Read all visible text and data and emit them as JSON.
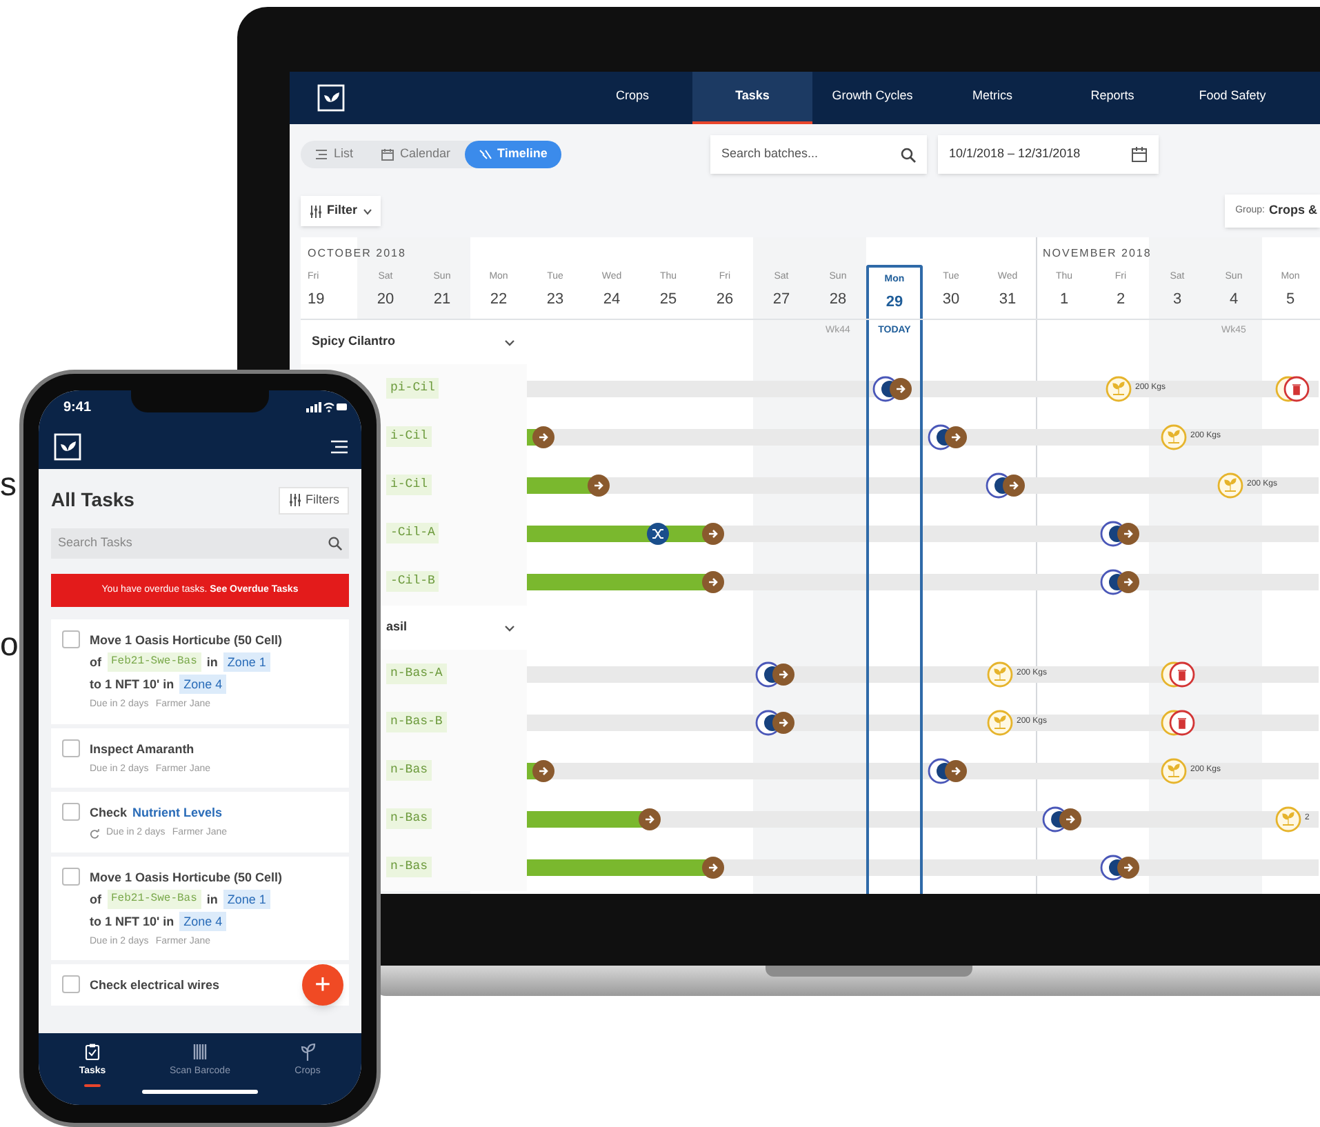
{
  "background_text": [
    "s",
    "o"
  ],
  "desktop": {
    "nav": {
      "tabs": [
        {
          "label": "Crops",
          "selected": false
        },
        {
          "label": "Tasks",
          "selected": true
        },
        {
          "label": "Growth Cycles",
          "selected": false
        },
        {
          "label": "Metrics",
          "selected": false
        },
        {
          "label": "Reports",
          "selected": false
        },
        {
          "label": "Food Safety",
          "selected": false
        }
      ]
    },
    "view_modes": [
      {
        "label": "List",
        "selected": false
      },
      {
        "label": "Calendar",
        "selected": false
      },
      {
        "label": "Timeline",
        "selected": true
      }
    ],
    "search": {
      "placeholder": "Search batches..."
    },
    "date_range": {
      "value": "10/1/2018 – 12/31/2018"
    },
    "filter": {
      "label": "Filter"
    },
    "group_by": {
      "label": "Group:",
      "value": "Crops &"
    },
    "days": [
      {
        "name": "Fri",
        "num": "19",
        "weekend": false,
        "selected": false,
        "month": "OCTOBER 2018"
      },
      {
        "name": "Sat",
        "num": "20",
        "weekend": true,
        "selected": false
      },
      {
        "name": "Sun",
        "num": "21",
        "weekend": true,
        "selected": false
      },
      {
        "name": "Mon",
        "num": "22",
        "weekend": false,
        "selected": false
      },
      {
        "name": "Tue",
        "num": "23",
        "weekend": false,
        "selected": false
      },
      {
        "name": "Wed",
        "num": "24",
        "weekend": false,
        "selected": false
      },
      {
        "name": "Thu",
        "num": "25",
        "weekend": false,
        "selected": false
      },
      {
        "name": "Fri",
        "num": "26",
        "weekend": false,
        "selected": false
      },
      {
        "name": "Sat",
        "num": "27",
        "weekend": true,
        "selected": false
      },
      {
        "name": "Sun",
        "num": "28",
        "weekend": true,
        "selected": false,
        "marker": "Wk44"
      },
      {
        "name": "Mon",
        "num": "29",
        "weekend": false,
        "selected": true,
        "marker": "TODAY"
      },
      {
        "name": "Tue",
        "num": "30",
        "weekend": false,
        "selected": false
      },
      {
        "name": "Wed",
        "num": "31",
        "weekend": false,
        "selected": false
      },
      {
        "name": "Thu",
        "num": "1",
        "weekend": false,
        "selected": false,
        "month": "NOVEMBER 2018"
      },
      {
        "name": "Fri",
        "num": "2",
        "weekend": false,
        "selected": false
      },
      {
        "name": "Sat",
        "num": "3",
        "weekend": true,
        "selected": false
      },
      {
        "name": "Sun",
        "num": "4",
        "weekend": true,
        "selected": false,
        "marker": "Wk45"
      },
      {
        "name": "Mon",
        "num": "5",
        "weekend": false,
        "selected": false
      }
    ],
    "groups": [
      {
        "name": "Spicy Cilantro",
        "expanded": true,
        "rows": [
          {
            "batch": "pi-Cil",
            "level": 0,
            "events": [
              {
                "kind": "transplant"
              },
              {
                "kind": "harvest",
                "label": "200 Kgs"
              },
              {
                "kind": "discard"
              }
            ]
          },
          {
            "batch": "i-Cil",
            "level": 0.02,
            "events": [
              {
                "kind": "move"
              },
              {
                "kind": "transplant"
              },
              {
                "kind": "harvest",
                "label": "200 Kgs"
              }
            ]
          },
          {
            "batch": "i-Cil",
            "level": 0.09,
            "events": [
              {
                "kind": "move"
              },
              {
                "kind": "transplant"
              },
              {
                "kind": "harvest",
                "label": "200 Kgs"
              }
            ]
          },
          {
            "batch": "-Cil-A",
            "level": 0.235,
            "events": [
              {
                "kind": "split"
              },
              {
                "kind": "move"
              },
              {
                "kind": "transplant"
              }
            ]
          },
          {
            "batch": "-Cil-B",
            "level": 0.235,
            "events": [
              {
                "kind": "move"
              },
              {
                "kind": "transplant"
              }
            ]
          }
        ]
      },
      {
        "name": "asil",
        "expanded": true,
        "rows": [
          {
            "batch": "n-Bas-A",
            "level": 0,
            "events": [
              {
                "kind": "transplant"
              },
              {
                "kind": "harvest",
                "label": "200 Kgs"
              },
              {
                "kind": "discard"
              }
            ]
          },
          {
            "batch": "n-Bas-B",
            "level": 0,
            "events": [
              {
                "kind": "transplant"
              },
              {
                "kind": "harvest",
                "label": "200 Kgs"
              },
              {
                "kind": "discard"
              }
            ]
          },
          {
            "batch": "n-Bas",
            "level": 0.02,
            "events": [
              {
                "kind": "move"
              },
              {
                "kind": "transplant"
              },
              {
                "kind": "harvest",
                "label": "200 Kgs"
              }
            ]
          },
          {
            "batch": "n-Bas",
            "level": 0.155,
            "events": [
              {
                "kind": "move"
              },
              {
                "kind": "transplant"
              },
              {
                "kind": "harvest",
                "label": "2"
              }
            ]
          },
          {
            "batch": "n-Bas",
            "level": 0.235,
            "events": [
              {
                "kind": "move"
              },
              {
                "kind": "transplant"
              }
            ]
          }
        ]
      }
    ]
  },
  "phone": {
    "time": "9:41",
    "title": "All Tasks",
    "filters_label": "Filters",
    "search": {
      "placeholder": "Search Tasks"
    },
    "alert": "You have overdue tasks. **See Overdue Tasks**",
    "tasks": [
      {
        "checked": false,
        "recurring": false,
        "lines": [
          [
            {
              "kind": "text",
              "text": "Move 1 Oasis Horticube (50 Cell)"
            }
          ],
          [
            {
              "kind": "text",
              "text": "of"
            },
            {
              "kind": "batch",
              "text": "Feb21-Swe-Bas"
            },
            {
              "kind": "text",
              "text": "in"
            },
            {
              "kind": "zone",
              "text": "Zone 1"
            }
          ],
          [
            {
              "kind": "text",
              "text": "to 1 NFT 10' in"
            },
            {
              "kind": "zone",
              "text": "Zone 4"
            }
          ]
        ],
        "due": "Due in 2 days",
        "assignee": "Farmer Jane"
      },
      {
        "checked": false,
        "recurring": false,
        "lines": [
          [
            {
              "kind": "text",
              "text": "Inspect Amaranth"
            }
          ]
        ],
        "due": "Due in 2 days",
        "assignee": "Farmer Jane"
      },
      {
        "checked": false,
        "recurring": true,
        "lines": [
          [
            {
              "kind": "text",
              "text": "Check"
            },
            {
              "kind": "link",
              "text": "Nutrient Levels"
            }
          ]
        ],
        "due": "Due in 2 days",
        "assignee": "Farmer Jane"
      },
      {
        "checked": false,
        "recurring": false,
        "lines": [
          [
            {
              "kind": "text",
              "text": "Move 1 Oasis Horticube (50 Cell)"
            }
          ],
          [
            {
              "kind": "text",
              "text": "of"
            },
            {
              "kind": "batch",
              "text": "Feb21-Swe-Bas"
            },
            {
              "kind": "text",
              "text": "in"
            },
            {
              "kind": "zone",
              "text": "Zone 1"
            }
          ],
          [
            {
              "kind": "text",
              "text": "to 1 NFT 10' in"
            },
            {
              "kind": "zone",
              "text": "Zone 4"
            }
          ]
        ],
        "due": "Due in 2 days",
        "assignee": "Farmer Jane"
      },
      {
        "checked": false,
        "lines": [
          [
            {
              "kind": "text",
              "text": "Check electrical wires"
            }
          ]
        ]
      }
    ],
    "fab": "+",
    "nav": [
      {
        "label": "Tasks",
        "selected": true
      },
      {
        "label": "Scan Barcode",
        "selected": false
      },
      {
        "label": "Crops",
        "selected": false
      }
    ]
  }
}
